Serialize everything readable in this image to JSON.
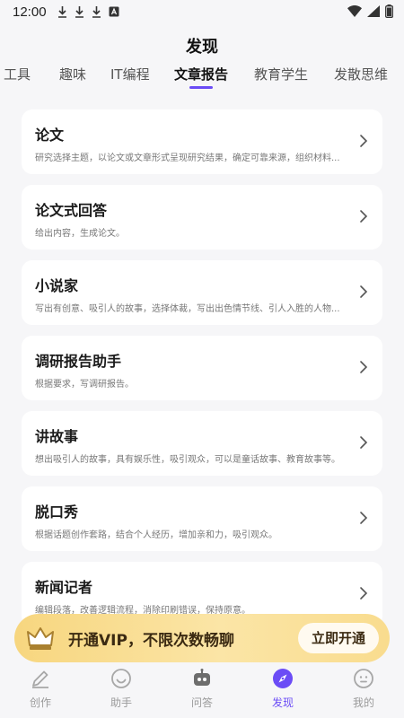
{
  "status_bar": {
    "time": "12:00"
  },
  "header": {
    "title": "发现"
  },
  "tabs": [
    {
      "label": "工具"
    },
    {
      "label": "趣味"
    },
    {
      "label": "IT编程"
    },
    {
      "label": "文章报告"
    },
    {
      "label": "教育学生"
    },
    {
      "label": "发散思维"
    }
  ],
  "active_tab_index": 3,
  "cards": [
    {
      "title": "论文",
      "desc": "研究选择主题，以论文或文章形式呈现研究结果，确定可靠来源，组织材料..."
    },
    {
      "title": "论文式回答",
      "desc": "给出内容，生成论文。"
    },
    {
      "title": "小说家",
      "desc": "写出有创意、吸引人的故事，选择体裁，写出出色情节线、引人入胜的人物..."
    },
    {
      "title": "调研报告助手",
      "desc": "根据要求，写调研报告。"
    },
    {
      "title": "讲故事",
      "desc": "想出吸引人的故事，具有娱乐性，吸引观众，可以是童话故事、教育故事等。"
    },
    {
      "title": "脱口秀",
      "desc": "根据话题创作套路，结合个人经历，增加亲和力，吸引观众。"
    },
    {
      "title": "新闻记者",
      "desc": "编辑段落，改善逻辑流程，消除印刷错误，保持原意。"
    }
  ],
  "vip_banner": {
    "text": "开通VIP，不限次数畅聊",
    "button_label": "立即开通"
  },
  "bottom_nav": [
    {
      "label": "创作",
      "icon": "pencil-icon"
    },
    {
      "label": "助手",
      "icon": "smile-icon"
    },
    {
      "label": "问答",
      "icon": "robot-icon"
    },
    {
      "label": "发现",
      "icon": "compass-icon"
    },
    {
      "label": "我的",
      "icon": "face-icon"
    }
  ],
  "colors": {
    "accent": "#6b4cf6",
    "vip_gold": "#f7d67f",
    "background": "#f6f6f8"
  }
}
